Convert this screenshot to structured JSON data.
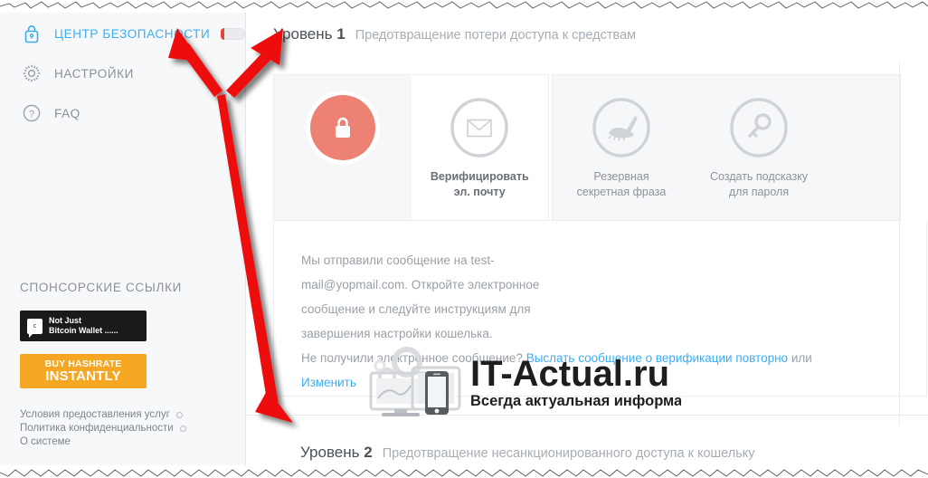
{
  "sidebar": {
    "nav": [
      {
        "label": "ЦЕНТР БЕЗОПАСНОСТИ",
        "icon": "lock-icon",
        "active": true,
        "has_toggle": true
      },
      {
        "label": "НАСТРОЙКИ",
        "icon": "gear-icon",
        "active": false,
        "has_toggle": false
      },
      {
        "label": "FAQ",
        "icon": "question-circle-icon",
        "active": false,
        "has_toggle": false
      }
    ],
    "sponsor_title": "СПОНСОРСКИЕ ССЫЛКИ",
    "ad_dark": {
      "badge": "c",
      "line1": "Not Just",
      "line2": "Bitcoin Wallet ......"
    },
    "ad_yellow": {
      "line1": "BUY HASHRATE",
      "line2": "INSTANTLY"
    },
    "footer_links": [
      {
        "label": "Условия предоставления услуг",
        "dot": true
      },
      {
        "label": "Политика конфиденциальности",
        "dot": true
      },
      {
        "label": "О системе",
        "dot": false
      }
    ]
  },
  "main": {
    "level1": {
      "prefix": "Уровень",
      "number": "1",
      "description": "Предотвращение потери доступа к средствам"
    },
    "level2": {
      "prefix": "Уровень",
      "number": "2",
      "description": "Предотвращение несанкционированного доступа к кошельку"
    },
    "tiles": [
      {
        "icon": "padlock-badge-icon",
        "label": "",
        "selected": false,
        "group": "a"
      },
      {
        "icon": "envelope-icon",
        "label_line1": "Верифицировать",
        "label_line2": "эл. почту",
        "selected": true,
        "group": "a"
      },
      {
        "icon": "hand-writing-icon",
        "label_line1": "Резервная",
        "label_line2": "секретная фраза",
        "selected": false,
        "group": "b"
      },
      {
        "icon": "key-icon",
        "label_line1": "Создать подсказку",
        "label_line2": "для пароля",
        "selected": false,
        "group": "b"
      }
    ],
    "message": {
      "line1": "Мы отправили сообщение на test-",
      "line2": "mail@yopmail.com. Откройте электронное",
      "line3": "сообщение и следуйте инструкциям для",
      "line4": "завершения настройки кошелька.",
      "line5_prefix": "Не получили электронное сообщение? ",
      "line5_link": "Выслать сообщение о верификации повторно",
      "line5_suffix": " или",
      "line6_link": "Изменить"
    }
  },
  "watermark": {
    "title": "IT-Actual.ru",
    "subtitle": "Всегда актуальная информация"
  },
  "colors": {
    "accent_blue": "#3dadf2",
    "lock_badge": "#ec8174",
    "toggle_red": "#e8443a",
    "ad_yellow": "#f5a623",
    "arrow_red": "#ee1111",
    "panel_bg": "#f6f7f9",
    "sidebar_bg": "#f7f8fa",
    "muted_text": "#9aa0a8"
  }
}
